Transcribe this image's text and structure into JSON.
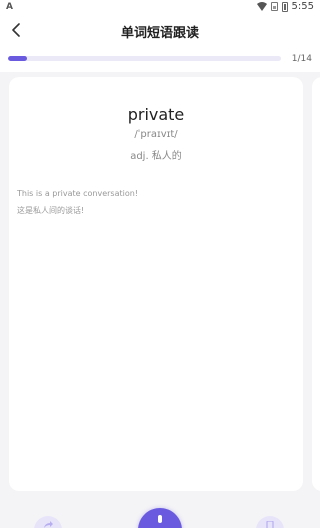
{
  "status_bar": {
    "left_icon": "A",
    "time": "5:55",
    "icons": [
      "wifi-icon",
      "sim-icon",
      "battery-icon"
    ]
  },
  "header": {
    "title": "单词短语跟读",
    "back_icon": "chevron-left-icon"
  },
  "progress": {
    "current": 1,
    "total": 14,
    "label": "1/14",
    "fraction": 0.0714,
    "fill_color": "#6a5ae0",
    "track_color": "#ebe9f7"
  },
  "card": {
    "word": "private",
    "phonetic": "/ˈpraɪvɪt/",
    "meaning": "adj. 私人的",
    "sentence_en": "This is a private conversation!",
    "sentence_zh": "这是私人间的谈话!"
  },
  "bottom_bar": {
    "accent_color": "#6a5ae0",
    "left_icon": "share-icon",
    "center_icon": "microphone-icon",
    "right_icon": "bookmark-icon"
  }
}
